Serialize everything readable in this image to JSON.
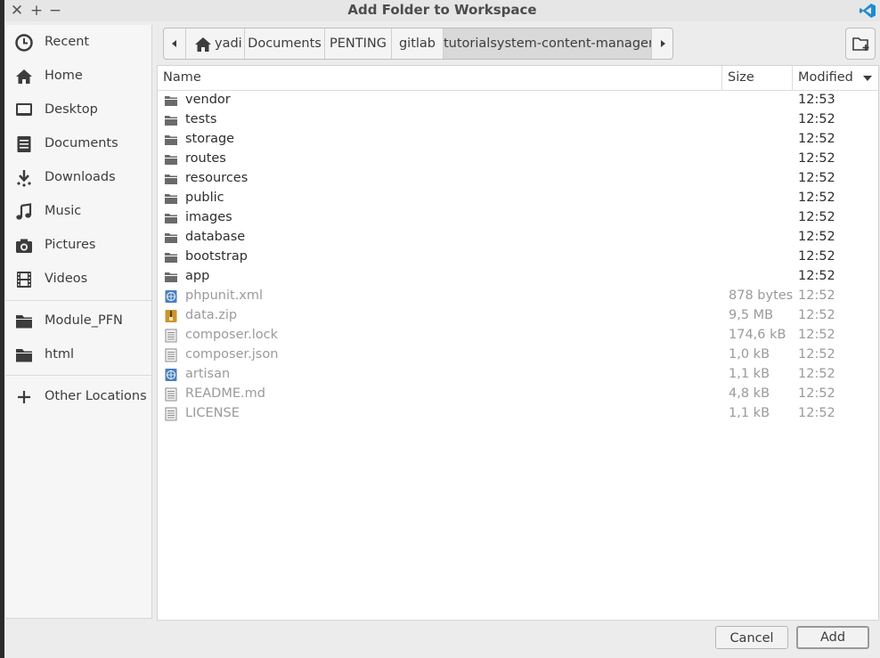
{
  "titlebar": {
    "title": "Add Folder to Workspace",
    "close_label": "✕",
    "maximize_label": "+",
    "minimize_label": "−",
    "app_icon": "vscode-icon",
    "accent": "#1f8ad2"
  },
  "sidebar": {
    "items": [
      {
        "label": "Recent",
        "icon": "clock-icon"
      },
      {
        "label": "Home",
        "icon": "home-icon"
      },
      {
        "label": "Desktop",
        "icon": "desktop-icon"
      },
      {
        "label": "Documents",
        "icon": "documents-icon"
      },
      {
        "label": "Downloads",
        "icon": "download-icon"
      },
      {
        "label": "Music",
        "icon": "music-icon"
      },
      {
        "label": "Pictures",
        "icon": "camera-icon"
      },
      {
        "label": "Videos",
        "icon": "film-icon"
      }
    ],
    "bookmarks": [
      {
        "label": "Module_PFN",
        "icon": "folder-icon"
      },
      {
        "label": "html",
        "icon": "folder-icon"
      }
    ],
    "other": {
      "label": "Other Locations",
      "icon": "plus-icon"
    }
  },
  "pathbar": {
    "crumbs": [
      "yadi",
      "Documents",
      "PENTING",
      "gitlab",
      "tutorialsystem-content-manager"
    ],
    "home_icon": "home-icon",
    "active_index": 4
  },
  "columns": {
    "name": "Name",
    "size": "Size",
    "modified": "Modified"
  },
  "files": [
    {
      "name": "vendor",
      "type": "folder",
      "size": "",
      "modified": "12:53"
    },
    {
      "name": "tests",
      "type": "folder",
      "size": "",
      "modified": "12:52"
    },
    {
      "name": "storage",
      "type": "folder",
      "size": "",
      "modified": "12:52"
    },
    {
      "name": "routes",
      "type": "folder",
      "size": "",
      "modified": "12:52"
    },
    {
      "name": "resources",
      "type": "folder",
      "size": "",
      "modified": "12:52"
    },
    {
      "name": "public",
      "type": "folder",
      "size": "",
      "modified": "12:52"
    },
    {
      "name": "images",
      "type": "folder",
      "size": "",
      "modified": "12:52"
    },
    {
      "name": "database",
      "type": "folder",
      "size": "",
      "modified": "12:52"
    },
    {
      "name": "bootstrap",
      "type": "folder",
      "size": "",
      "modified": "12:52"
    },
    {
      "name": "app",
      "type": "folder",
      "size": "",
      "modified": "12:52"
    },
    {
      "name": "phpunit.xml",
      "type": "web",
      "size": "878 bytes",
      "modified": "12:52"
    },
    {
      "name": "data.zip",
      "type": "archive",
      "size": "9,5 MB",
      "modified": "12:52"
    },
    {
      "name": "composer.lock",
      "type": "text",
      "size": "174,6 kB",
      "modified": "12:52"
    },
    {
      "name": "composer.json",
      "type": "text",
      "size": "1,0 kB",
      "modified": "12:52"
    },
    {
      "name": "artisan",
      "type": "web",
      "size": "1,1 kB",
      "modified": "12:52"
    },
    {
      "name": "README.md",
      "type": "text",
      "size": "4,8 kB",
      "modified": "12:52"
    },
    {
      "name": "LICENSE",
      "type": "text",
      "size": "1,1 kB",
      "modified": "12:52"
    }
  ],
  "buttons": {
    "cancel": "Cancel",
    "add": "Add"
  }
}
